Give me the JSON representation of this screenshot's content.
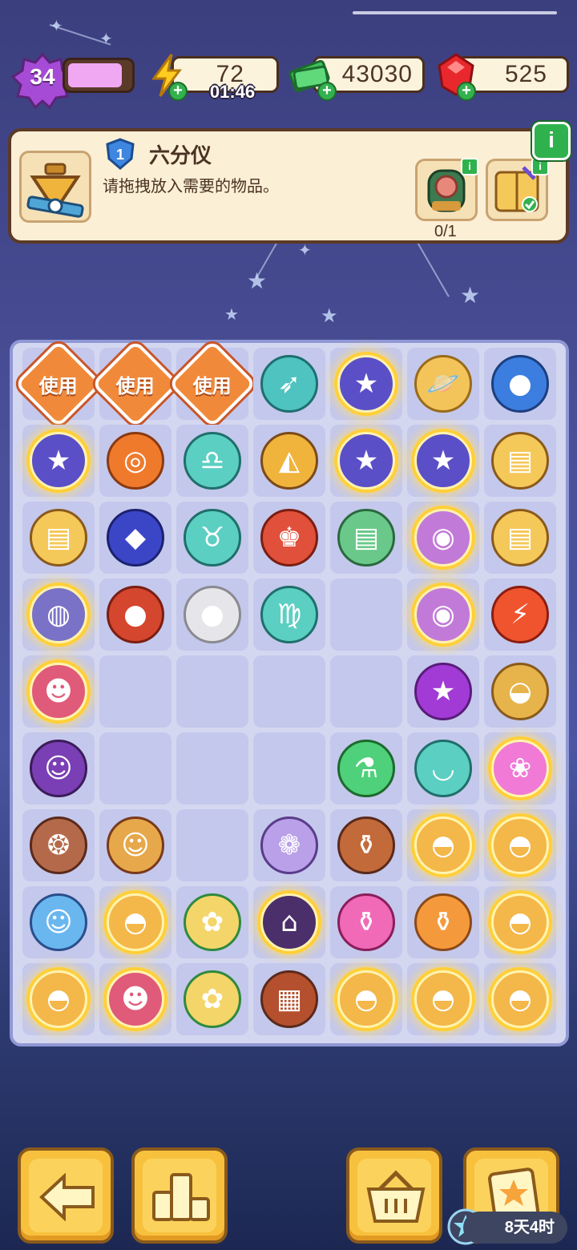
{
  "hud": {
    "level": "34",
    "level_progress": 0.82,
    "energy": {
      "value": "72",
      "timer": "01:46"
    },
    "cash": {
      "value": "43030"
    },
    "gems": {
      "value": "525"
    }
  },
  "quest": {
    "level_badge": "1",
    "title": "六分仪",
    "description": "请拖拽放入需要的物品。",
    "progress": "0/1",
    "info_label": "i",
    "req_info_label": "i"
  },
  "board": {
    "use_label": "使用",
    "rows": [
      [
        "use-tag",
        "use-tag",
        "use-tag",
        "sagittarius-icon",
        "star-orb-glow",
        "saturn-planet-icon",
        "blue-planet-icon"
      ],
      [
        "star-orb-glow",
        "orange-planet-icon",
        "libra-icon",
        "sextant-icon",
        "star-orb-glow",
        "star-orb-glow",
        "tarot-cards-icon"
      ],
      [
        "tarot-cards-icon",
        "blue-gem-icon",
        "taurus-icon",
        "king-figure-icon",
        "tarot-cards-rainbow-icon",
        "crystal-ball-glow",
        "tarot-cards-icon"
      ],
      [
        "owl-portrait-glow",
        "red-planet-icon",
        "moon-icon",
        "virgo-icon",
        "empty",
        "crystal-ball-glow",
        "lightning-coin-icon"
      ],
      [
        "fortune-teller-glow",
        "empty",
        "empty",
        "empty",
        "empty",
        "purple-star-icon",
        "coin-bag-icon"
      ],
      [
        "wizard-icon",
        "empty",
        "empty",
        "empty",
        "test-tube-icon",
        "green-bowl-icon",
        "pink-orb-glow"
      ],
      [
        "toad-icon",
        "scholar-icon",
        "empty",
        "lavender-jar-icon",
        "potion-bottle-icon",
        "treasure-bowl-glow",
        "treasure-bowl-glow"
      ],
      [
        "seer-character-icon",
        "treasure-bowl-glow",
        "rose-jar-icon",
        "dark-portal-glow",
        "pink-potion-icon",
        "orange-potion-icon",
        "treasure-bowl-glow"
      ],
      [
        "treasure-bowl-glow",
        "fortune-teller-glow",
        "rose-jar-icon",
        "retro-tv-icon",
        "treasure-bowl-glow",
        "treasure-bowl-glow",
        "treasure-bowl-glow"
      ]
    ]
  },
  "bottom": {
    "back": "arrow-left-icon",
    "rank": "podium-icon",
    "shop": "basket-icon",
    "event": "star-card-icon",
    "event_timer": "8天4时"
  },
  "colors": {
    "accent": "#f7c13e",
    "board_bg": "#d4d7f0",
    "card_bg": "#fbefd6"
  }
}
